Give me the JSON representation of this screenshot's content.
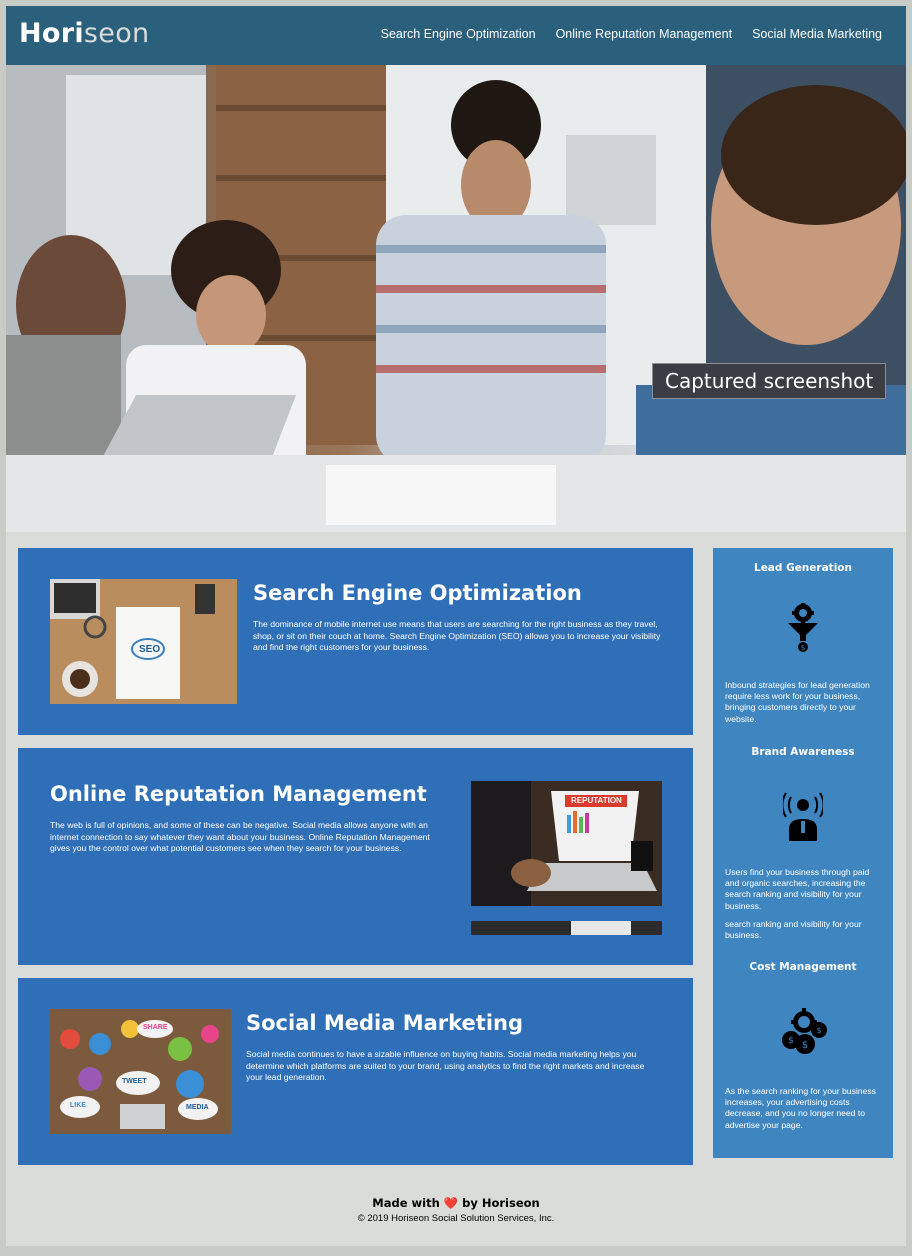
{
  "header": {
    "logo_primary": "Hori",
    "logo_accent": "seon",
    "nav": [
      "Search Engine Optimization",
      "Online Reputation Management",
      "Social Media Marketing"
    ]
  },
  "hero": {
    "caption": "Captured screenshot"
  },
  "content": [
    {
      "title": "Search Engine Optimization",
      "body": "The dominance of mobile internet use means that users are searching for the right business as they travel, shop, or sit on their couch at home. Search Engine Optimization (SEO) allows you to increase your visibility and find the right customers for your business.",
      "image_label": "SEO"
    },
    {
      "title": "Online Reputation Management",
      "body": "The web is full of opinions, and some of these can be negative. Social media allows anyone with an internet connection to say whatever they want about your business. Online Reputation Management gives you the control over what potential customers see when they search for your business.",
      "image_label": "REPUTATION"
    },
    {
      "title": "Social Media Marketing",
      "body": "Social media continues to have a sizable influence on buying habits. Social media marketing helps you determine which platforms are suited to your brand, using analytics to find the right markets and increase your lead generation.",
      "image_labels": [
        "SHARE",
        "TWEET",
        "LIKE",
        "MEDIA"
      ]
    }
  ],
  "aside": [
    {
      "title": "Lead Generation",
      "icon": "lead-generation-icon",
      "body": "Inbound strategies for lead generation require less work for your business, bringing customers directly to your website."
    },
    {
      "title": "Brand Awareness",
      "icon": "brand-awareness-icon",
      "body": "Users find your business through paid and organic searches, increasing the search ranking and visibility for your business.",
      "body_extra": "search ranking and visibility for your business."
    },
    {
      "title": "Cost Management",
      "icon": "cost-management-icon",
      "body": "As the search ranking for your business increases, your advertising costs decrease, and you no longer need to advertise your page."
    }
  ],
  "footer": {
    "made_prefix": "Made with",
    "heart": "❤️",
    "made_suffix": "by Horiseon",
    "copyright": "© 2019 Horiseon Social Solution Services, Inc."
  },
  "colors": {
    "header_bg": "#2a607c",
    "card_bg": "#2f6fb7",
    "aside_bg": "#3f86c0",
    "page_bg": "#d9dcd8"
  }
}
